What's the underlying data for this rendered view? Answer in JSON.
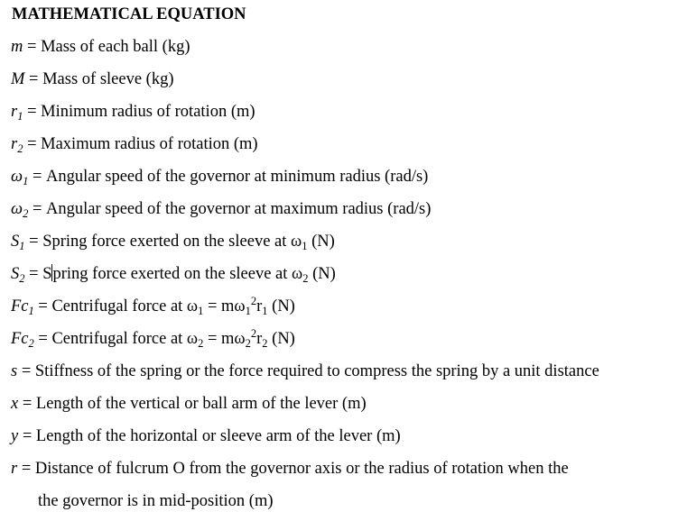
{
  "title": "MATHEMATICAL EQUATION",
  "lines": [
    {
      "sym": "m",
      "sym_sub": "",
      "eq": " = ",
      "text": "Mass of each ball (kg)"
    },
    {
      "sym": "M",
      "sym_sub": "",
      "eq": " = ",
      "text": "Mass of sleeve (kg)"
    },
    {
      "sym": "r",
      "sym_sub": "1",
      "eq": " = ",
      "text": "Minimum radius of rotation (m)"
    },
    {
      "sym": "r",
      "sym_sub": "2",
      "eq": " = ",
      "text": "Maximum radius of rotation (m)"
    },
    {
      "sym": "ω",
      "sym_sub": "1",
      "eq": " = ",
      "text": "Angular speed of the governor at minimum radius (rad/s)"
    },
    {
      "sym": "ω",
      "sym_sub": "2",
      "eq": " = ",
      "text": "Angular speed of the governor at maximum radius (rad/s)"
    },
    {
      "sym": "S",
      "sym_sub": "1",
      "eq": " = ",
      "text_pre": "Spring force exerted on the sleeve at ω",
      "text_sub": "1",
      "text_post": " (N)"
    },
    {
      "sym": "S",
      "sym_sub": "2",
      "eq": " = ",
      "text_a": "S",
      "text_b": "pring force exerted on the sleeve at ω",
      "text_sub": "2",
      "text_post": " (N)"
    },
    {
      "sym": "Fc",
      "sym_sub": "1",
      "eq": " = ",
      "text_pre": "Centrifugal force at ω",
      "w_sub": "1",
      "mid": " = mω",
      "mw_sub": "1",
      "sup": "2",
      "r": "r",
      "r_sub": "1",
      "text_post": " (N)"
    },
    {
      "sym": "Fc",
      "sym_sub": "2",
      "eq": " = ",
      "text_pre": "Centrifugal force at ω",
      "w_sub": "2",
      "mid": " = mω",
      "mw_sub": "2",
      "sup": "2",
      "r": "r",
      "r_sub": "2",
      "text_post": " (N)"
    },
    {
      "sym": "s",
      "sym_sub": "",
      "eq": " = ",
      "text": "Stiffness of the spring or the force required to compress the spring by a unit distance"
    },
    {
      "sym": "x",
      "sym_sub": "",
      "eq": " = ",
      "text": "Length of the vertical or ball arm of the lever (m)"
    },
    {
      "sym": "y",
      "sym_sub": "",
      "eq": " = ",
      "text": "Length of the horizontal or sleeve arm of the lever (m)"
    },
    {
      "sym": "r",
      "sym_sub": "",
      "eq": " = ",
      "text": "Distance of fulcrum O from the governor axis or the radius of rotation when the"
    },
    {
      "text": "the governor is in mid-position (m)"
    }
  ]
}
